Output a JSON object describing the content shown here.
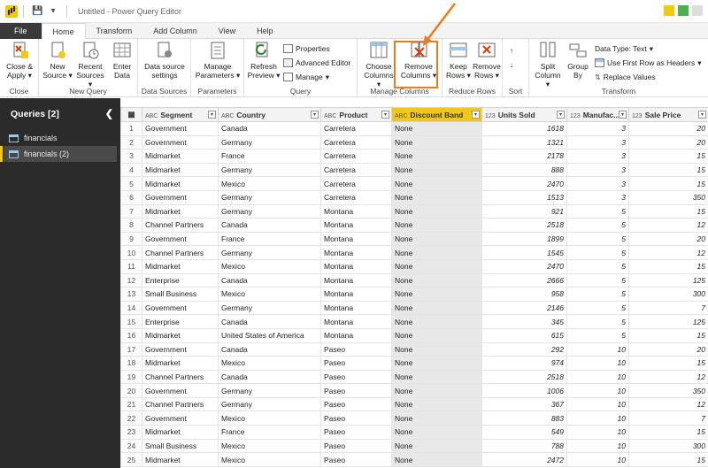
{
  "window": {
    "title": "Untitled - Power Query Editor"
  },
  "tabs": [
    {
      "label": "File"
    },
    {
      "label": "Home"
    },
    {
      "label": "Transform"
    },
    {
      "label": "Add Column"
    },
    {
      "label": "View"
    },
    {
      "label": "Help"
    }
  ],
  "ribbon": {
    "close": {
      "label": "Close",
      "close_apply": "Close &",
      "close_apply2": "Apply"
    },
    "new_query": {
      "label": "New Query",
      "new_source": "New",
      "new_source2": "Source",
      "recent": "Recent",
      "recent2": "Sources",
      "enter": "Enter",
      "enter2": "Data"
    },
    "data_sources": {
      "label": "Data Sources",
      "btn": "Data source",
      "btn2": "settings"
    },
    "parameters": {
      "label": "Parameters",
      "btn": "Manage",
      "btn2": "Parameters"
    },
    "query": {
      "label": "Query",
      "refresh": "Refresh",
      "refresh2": "Preview",
      "properties": "Properties",
      "advanced": "Advanced Editor",
      "manage": "Manage"
    },
    "manage_columns": {
      "label": "Manage Columns",
      "choose": "Choose",
      "choose2": "Columns",
      "remove": "Remove",
      "remove2": "Columns"
    },
    "reduce_rows": {
      "label": "Reduce Rows",
      "keep": "Keep",
      "keep2": "Rows",
      "remove": "Remove",
      "remove2": "Rows"
    },
    "sort": {
      "label": "Sort"
    },
    "transform": {
      "label": "Transform",
      "split": "Split",
      "split2": "Column",
      "group": "Group",
      "group2": "By",
      "datatype": "Data Type: Text",
      "firstrow": "Use First Row as Headers",
      "replace": "Replace Values"
    }
  },
  "queries": {
    "header": "Queries [2]",
    "items": [
      {
        "label": "financials"
      },
      {
        "label": "financials (2)"
      }
    ]
  },
  "grid": {
    "columns": [
      {
        "type": "ABC",
        "label": "Segment"
      },
      {
        "type": "ABC",
        "label": "Country"
      },
      {
        "type": "ABC",
        "label": "Product"
      },
      {
        "type": "ABC",
        "label": "Discount Band"
      },
      {
        "type": "123",
        "label": "Units Sold"
      },
      {
        "type": "123",
        "label": "Manufac..."
      },
      {
        "type": "123",
        "label": "Sale Price"
      }
    ],
    "rows": [
      [
        "1",
        "Government",
        "Canada",
        "Carretera",
        "None",
        "1618",
        "3",
        "20"
      ],
      [
        "2",
        "Government",
        "Germany",
        "Carretera",
        "None",
        "1321",
        "3",
        "20"
      ],
      [
        "3",
        "Midmarket",
        "France",
        "Carretera",
        "None",
        "2178",
        "3",
        "15"
      ],
      [
        "4",
        "Midmarket",
        "Germany",
        "Carretera",
        "None",
        "888",
        "3",
        "15"
      ],
      [
        "5",
        "Midmarket",
        "Mexico",
        "Carretera",
        "None",
        "2470",
        "3",
        "15"
      ],
      [
        "6",
        "Government",
        "Germany",
        "Carretera",
        "None",
        "1513",
        "3",
        "350"
      ],
      [
        "7",
        "Midmarket",
        "Germany",
        "Montana",
        "None",
        "921",
        "5",
        "15"
      ],
      [
        "8",
        "Channel Partners",
        "Canada",
        "Montana",
        "None",
        "2518",
        "5",
        "12"
      ],
      [
        "9",
        "Government",
        "France",
        "Montana",
        "None",
        "1899",
        "5",
        "20"
      ],
      [
        "10",
        "Channel Partners",
        "Germany",
        "Montana",
        "None",
        "1545",
        "5",
        "12"
      ],
      [
        "11",
        "Midmarket",
        "Mexico",
        "Montana",
        "None",
        "2470",
        "5",
        "15"
      ],
      [
        "12",
        "Enterprise",
        "Canada",
        "Montana",
        "None",
        "2666",
        "5",
        "125"
      ],
      [
        "13",
        "Small Business",
        "Mexico",
        "Montana",
        "None",
        "958",
        "5",
        "300"
      ],
      [
        "14",
        "Government",
        "Germany",
        "Montana",
        "None",
        "2146",
        "5",
        "7"
      ],
      [
        "15",
        "Enterprise",
        "Canada",
        "Montana",
        "None",
        "345",
        "5",
        "125"
      ],
      [
        "16",
        "Midmarket",
        "United States of America",
        "Montana",
        "None",
        "615",
        "5",
        "15"
      ],
      [
        "17",
        "Government",
        "Canada",
        "Paseo",
        "None",
        "292",
        "10",
        "20"
      ],
      [
        "18",
        "Midmarket",
        "Mexico",
        "Paseo",
        "None",
        "974",
        "10",
        "15"
      ],
      [
        "19",
        "Channel Partners",
        "Canada",
        "Paseo",
        "None",
        "2518",
        "10",
        "12"
      ],
      [
        "20",
        "Government",
        "Germany",
        "Paseo",
        "None",
        "1006",
        "10",
        "350"
      ],
      [
        "21",
        "Channel Partners",
        "Germany",
        "Paseo",
        "None",
        "367",
        "10",
        "12"
      ],
      [
        "22",
        "Government",
        "Mexico",
        "Paseo",
        "None",
        "883",
        "10",
        "7"
      ],
      [
        "23",
        "Midmarket",
        "France",
        "Paseo",
        "None",
        "549",
        "10",
        "15"
      ],
      [
        "24",
        "Small Business",
        "Mexico",
        "Paseo",
        "None",
        "788",
        "10",
        "300"
      ],
      [
        "25",
        "Midmarket",
        "Mexico",
        "Paseo",
        "None",
        "2472",
        "10",
        "15"
      ]
    ]
  },
  "colors": {
    "accent": "#f2c811",
    "highlight": "#e87d1e",
    "panel": "#2b2b2b"
  }
}
